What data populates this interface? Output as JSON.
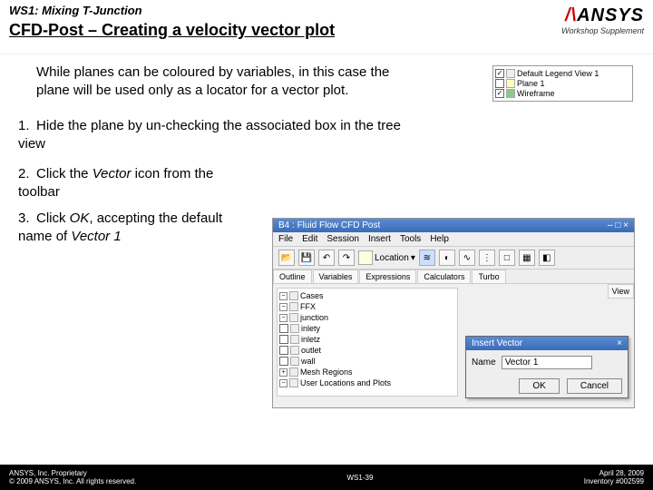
{
  "header": {
    "workshop": "WS1: Mixing T-Junction",
    "title": "CFD-Post – Creating a velocity vector plot",
    "supplement": "Workshop Supplement",
    "logo1": "ANSYS"
  },
  "intro": "While planes can be coloured by variables, in this case the plane will be used only as a locator for a vector plot.",
  "steps": {
    "s1": "Hide the plane by un-checking the associated box in the tree view",
    "s2a": "Click the ",
    "s2b": "Vector",
    "s2c": " icon from the toolbar",
    "s3a": "Click ",
    "s3b": "OK",
    "s3c": ", accepting the default name of ",
    "s3d": "Vector 1"
  },
  "tree_small": {
    "item1": "Default Legend View 1",
    "item2": "Plane 1",
    "item3": "Wireframe"
  },
  "app": {
    "wintitle": "B4 : Fluid Flow  CFD Post",
    "menu": [
      "File",
      "Edit",
      "Session",
      "Insert",
      "Tools",
      "Help"
    ],
    "loc_label": "Location",
    "tabs": [
      "Outline",
      "Variables",
      "Expressions",
      "Calculators",
      "Turbo"
    ],
    "tree": {
      "cases": "Cases",
      "ffx": "FFX",
      "junction": "junction",
      "inlety": "inlety",
      "inletz": "inletz",
      "outlet": "outlet",
      "wall": "wall",
      "ulp": "User Locations and Plots",
      "mesh": "Mesh Regions"
    },
    "viewbtn": "View"
  },
  "dialog": {
    "title": "Insert Vector",
    "name_label": "Name",
    "name_value": "Vector 1",
    "ok": "OK",
    "cancel": "Cancel"
  },
  "footer": {
    "left1": "ANSYS, Inc. Proprietary",
    "left2": "© 2009 ANSYS, Inc. All rights reserved.",
    "center": "WS1-39",
    "right1": "April 28, 2009",
    "right2": "Inventory #002599"
  }
}
